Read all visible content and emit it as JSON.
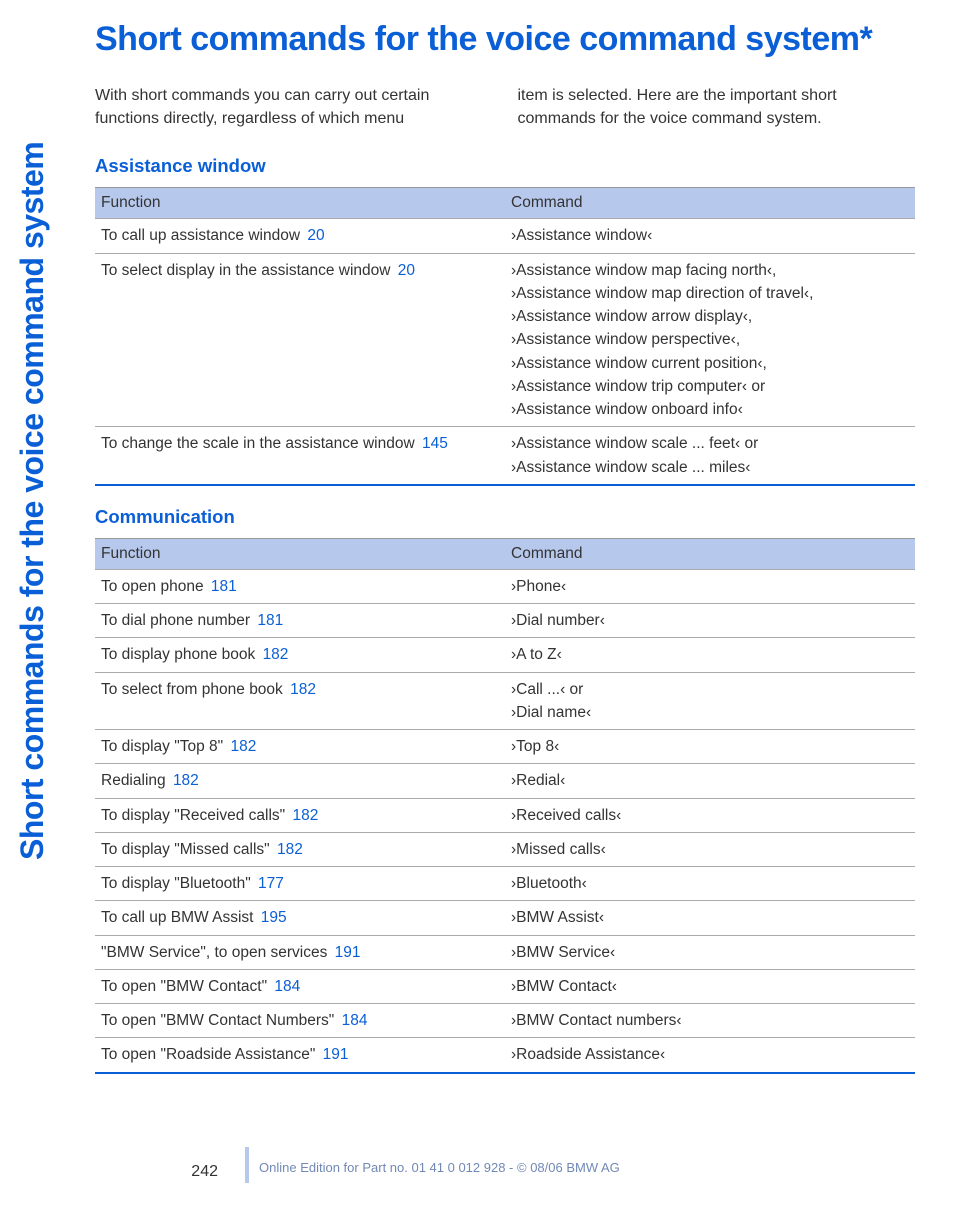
{
  "sidebar": "Short commands for the voice command system",
  "title": "Short commands for the voice command system*",
  "intro": {
    "left": "With short commands you can carry out certain functions directly, regardless of which menu",
    "right": "item is selected. Here are the important short commands for the voice command system."
  },
  "sections": [
    {
      "heading": "Assistance window",
      "headers": {
        "function": "Function",
        "command": "Command"
      },
      "rows": [
        {
          "function": "To call up assistance window",
          "pageref": "20",
          "command": "›Assistance window‹"
        },
        {
          "function": "To select display in the assistance window",
          "pageref": "20",
          "command": "›Assistance window map facing north‹,\n›Assistance window map direction of travel‹,\n›Assistance window arrow display‹,\n›Assistance window perspective‹,\n›Assistance window current position‹,\n›Assistance window trip computer‹ or\n›Assistance window onboard info‹"
        },
        {
          "function": "To change the scale in the assistance window",
          "pageref": "145",
          "command": "›Assistance window scale ... feet‹ or\n›Assistance window scale ... miles‹"
        }
      ]
    },
    {
      "heading": "Communication",
      "headers": {
        "function": "Function",
        "command": "Command"
      },
      "rows": [
        {
          "function": "To open phone",
          "pageref": "181",
          "command": "›Phone‹"
        },
        {
          "function": "To dial phone number",
          "pageref": "181",
          "command": "›Dial number‹"
        },
        {
          "function": "To display phone book",
          "pageref": "182",
          "command": "›A to Z‹"
        },
        {
          "function": "To select from phone book",
          "pageref": "182",
          "command": "›Call ...‹ or\n›Dial name‹"
        },
        {
          "function": "To display \"Top 8\"",
          "pageref": "182",
          "command": "›Top 8‹"
        },
        {
          "function": "Redialing",
          "pageref": "182",
          "command": "›Redial‹"
        },
        {
          "function": "To display \"Received calls\"",
          "pageref": "182",
          "command": "›Received calls‹"
        },
        {
          "function": "To display \"Missed calls\"",
          "pageref": "182",
          "command": "›Missed calls‹"
        },
        {
          "function": "To display \"Bluetooth\"",
          "pageref": "177",
          "command": "›Bluetooth‹"
        },
        {
          "function": "To call up BMW Assist",
          "pageref": "195",
          "command": "›BMW Assist‹"
        },
        {
          "function": "\"BMW Service\", to open services",
          "pageref": "191",
          "command": "›BMW Service‹"
        },
        {
          "function": "To open \"BMW Contact\"",
          "pageref": "184",
          "command": "›BMW Contact‹"
        },
        {
          "function": "To open \"BMW Contact Numbers\"",
          "pageref": "184",
          "command": "›BMW Contact numbers‹"
        },
        {
          "function": "To open \"Roadside Assistance\"",
          "pageref": "191",
          "command": "›Roadside Assistance‹"
        }
      ]
    }
  ],
  "footer": {
    "page": "242",
    "edition": "Online Edition for Part no. 01 41 0 012 928 - © 08/06 BMW AG"
  }
}
